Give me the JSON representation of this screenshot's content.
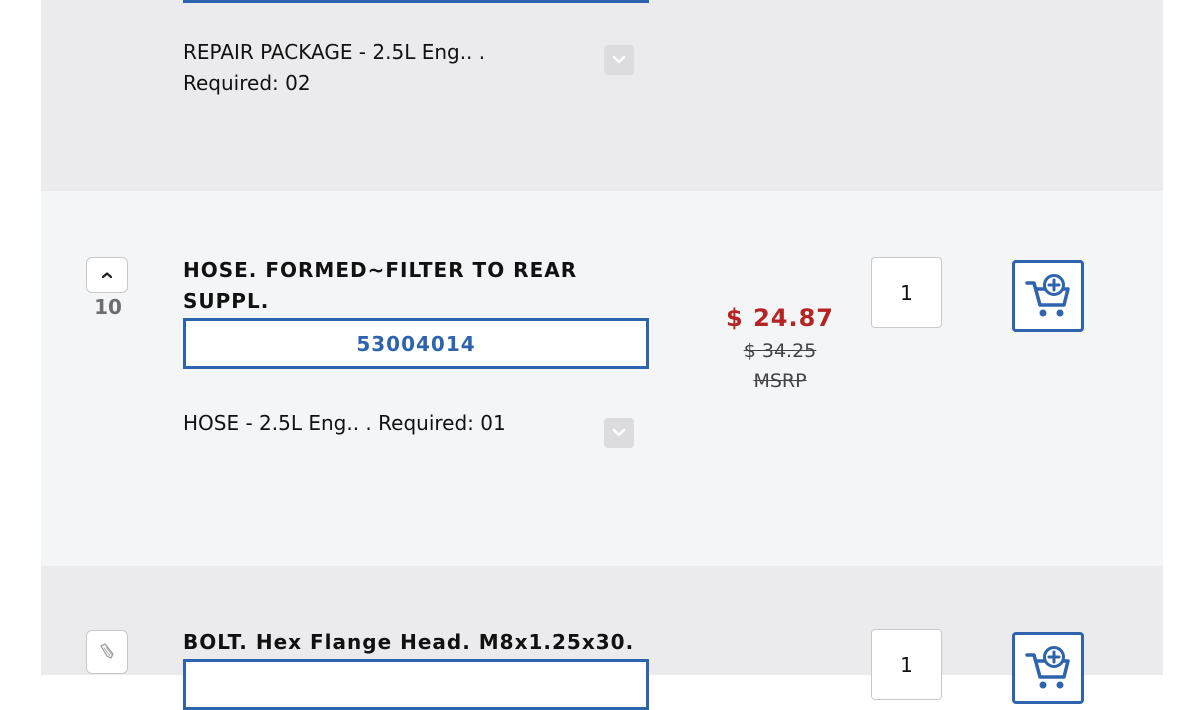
{
  "rows": [
    {
      "part_description": "REPAIR PACKAGE - 2.5L Eng.. .",
      "required": "Required: 02",
      "expand_icon": "chevron-down-icon"
    },
    {
      "ref_number": "10",
      "title_line1": "HOSE. FORMED~FILTER TO REAR",
      "title_line2": "SUPPL.",
      "part_number": "53004014",
      "part_description": "HOSE - 2.5L Eng.. . Required: 01",
      "price": "$ 24.87",
      "old_price": "$ 34.25",
      "msrp_label": "MSRP",
      "quantity": "1",
      "collapse_icon": "chevron-up-icon",
      "expand_icon": "chevron-down-icon",
      "cart_icon": "add-to-cart-icon"
    },
    {
      "title": "BOLT. Hex Flange Head. M8x1.25x30.",
      "quantity": "1",
      "thumbnail_icon": "bolt-thumbnail-icon",
      "cart_icon": "add-to-cart-icon"
    }
  ],
  "colors": {
    "accent_blue": "#2e64ad",
    "price_red": "#b52323",
    "row_alt_bg": "#ebebed",
    "row_bg": "#f4f5f7"
  }
}
